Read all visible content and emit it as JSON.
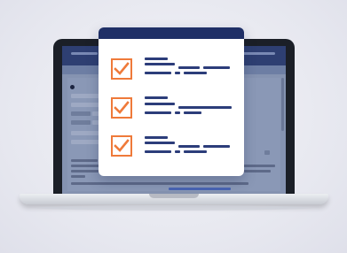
{
  "illustration": {
    "subject": "checklist-over-laptop",
    "card": {
      "items": [
        {
          "checked": true
        },
        {
          "checked": true
        },
        {
          "checked": true
        }
      ]
    }
  },
  "colors": {
    "background": "#ecedf3",
    "card_header": "#1f2f66",
    "checkbox_accent": "#ef7a3a",
    "text_lines": "#2c3d7a",
    "screen": "#8593b1",
    "screen_header": "#2e3f72"
  }
}
